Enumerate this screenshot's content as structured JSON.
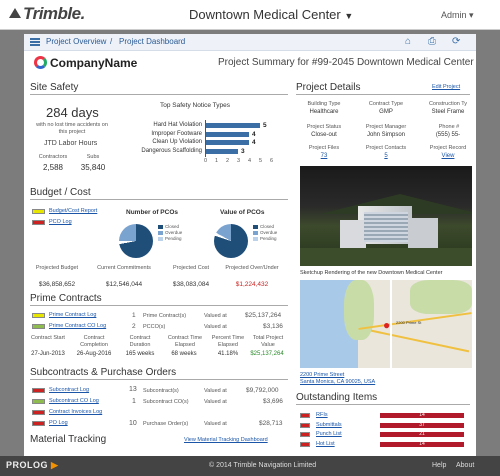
{
  "header": {
    "logo": "Trimble.",
    "project": "Downtown Medical Center",
    "admin": "Admin"
  },
  "nav": {
    "overview": "Project Overview",
    "sep": "/",
    "dashboard": "Project Dashboard"
  },
  "company": "CompanyName",
  "summary": "Project Summary for #99-2045 Downtown Medical Center",
  "site_safety": {
    "title": "Site Safety",
    "days": "284 days",
    "days_note": "with no lost time accidents on this project",
    "jtd": "JTD Labor Hours",
    "contractors_label": "Contractors",
    "subs_label": "Subs",
    "contractors": "2,588",
    "subs": "35,840"
  },
  "chart_data": {
    "type": "bar",
    "title": "Top Safety Notice Types",
    "categories": [
      "Hard Hat Violation",
      "Improper Footware",
      "Clean Up Violation",
      "Dangerous Scaffolding"
    ],
    "values": [
      5,
      4,
      4,
      3
    ],
    "xlim": [
      0,
      6
    ],
    "ticks": [
      "0",
      "1",
      "2",
      "3",
      "4",
      "5",
      "6"
    ]
  },
  "budget": {
    "title": "Budget / Cost",
    "report": "Budget/Cost Report",
    "pco": "PCO Log",
    "num_pcos": "Number of PCOs",
    "val_pcos": "Value of PCOs",
    "legend": [
      "Closed",
      "Overdue",
      "Pending"
    ],
    "proj_budget_l": "Projected Budget",
    "cur_commit_l": "Current Commitments",
    "proj_cost_l": "Projected Cost",
    "proj_over_l": "Projected Over/Under",
    "proj_budget": "$36,858,652",
    "cur_commit": "$12,546,044",
    "proj_cost": "$38,083,084",
    "proj_over": "$1,224,432"
  },
  "prime": {
    "title": "Prime Contracts",
    "log": "Prime Contract Log",
    "colog": "Prime Contract CO Log",
    "n1": "1",
    "n2": "2",
    "l1": "Prime Contract(s)",
    "l2": "PCCO(s)",
    "va": "Valued at",
    "v1": "$25,137,264",
    "v2": "$3,136",
    "cs": "Contract Start",
    "cc": "Contract Completion",
    "cd": "Contract Duration",
    "cte": "Contract Time Elapsed",
    "pte": "Percent Time Elapsed",
    "tpv": "Total Project Value",
    "csv": "27-Jun-2013",
    "ccv": "26-Aug-2016",
    "cdv": "165 weeks",
    "ctev": "68 weeks",
    "ptev": "41.18%",
    "tpvv": "$25,137,264"
  },
  "subs": {
    "title": "Subcontracts & Purchase Orders",
    "log": "Subcontract Log",
    "colog": "Subcontract CO Log",
    "inv": "Contract Invoices Log",
    "po": "PO Log",
    "n1": "13",
    "n2": "1",
    "n3": "10",
    "l1": "Subcontract(s)",
    "l2": "Subcontract CO(s)",
    "l3": "Purchase Order(s)",
    "va": "Valued at",
    "v1": "$9,792,000",
    "v2": "$3,696",
    "v3": "$28,713"
  },
  "material": {
    "title": "Material Tracking",
    "link": "View Material Tracking Dashboard"
  },
  "details": {
    "title": "Project Details",
    "edit": "Edit Project",
    "bt_l": "Building Type",
    "bt": "Healthcare",
    "ct_l": "Contract Type",
    "ct": "GMP",
    "cst_l": "Construction Ty",
    "cst": "Steel Frame",
    "ps_l": "Project Status",
    "ps": "Close-out",
    "pm_l": "Project Manager",
    "pm": "John Simpson",
    "ph_l": "Phone #",
    "ph": "(555) 55-",
    "pf_l": "Project Files",
    "pf": "73",
    "pc_l": "Project Contacts",
    "pc": "5",
    "pr_l": "Project Record",
    "pr": "View"
  },
  "render_caption": "Sketchup Rendering of the new Downtown Medical Center",
  "map": {
    "address1": "2200 Prime Street",
    "address2": "Santa Monica, CA 90025, USA",
    "pin": "2200 Prime St"
  },
  "outstanding": {
    "title": "Outstanding Items",
    "items": [
      {
        "label": "RFIs",
        "count": "14"
      },
      {
        "label": "Submittals",
        "count": "37"
      },
      {
        "label": "Punch List",
        "count": "21"
      },
      {
        "label": "Hot List",
        "count": "14"
      }
    ]
  },
  "footer": {
    "prolog": "PROLOG",
    "copy": "© 2014 Trimble Navigation Limited",
    "help": "Help",
    "about": "About"
  }
}
